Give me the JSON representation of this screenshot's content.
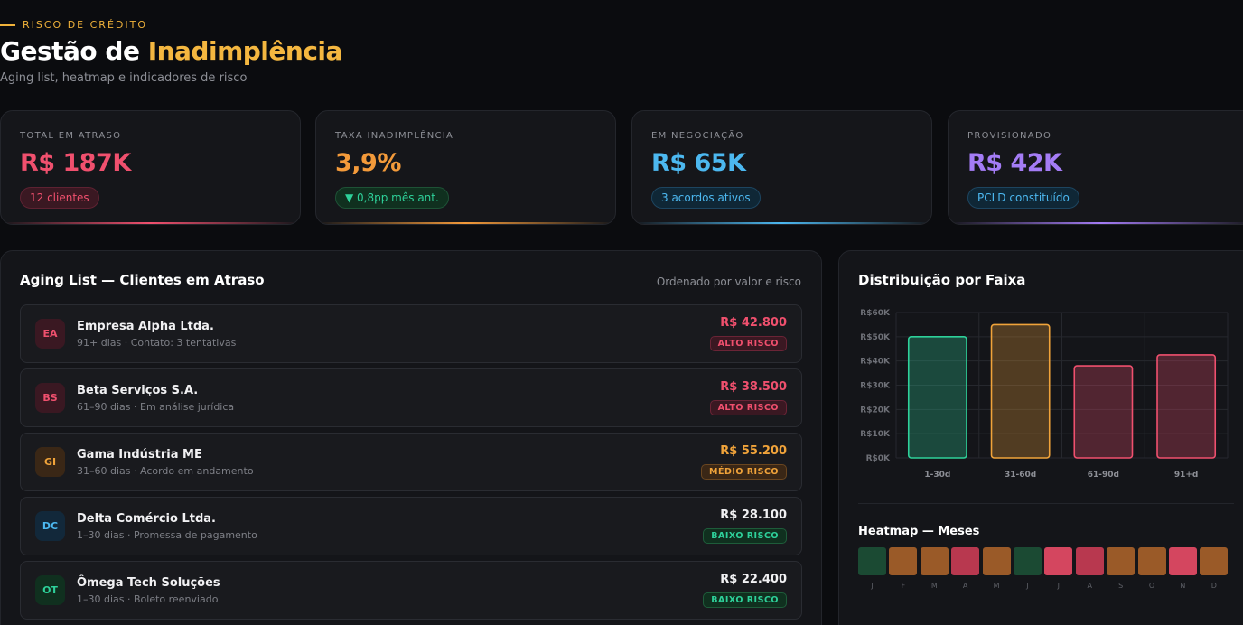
{
  "header": {
    "eyebrow": "RISCO DE CRÉDITO",
    "title_main": "Gestão de ",
    "title_highlight": "Inadimplência",
    "subtitle": "Aging list, heatmap e indicadores de risco"
  },
  "kpis": [
    {
      "label": "TOTAL EM ATRASO",
      "value": "R$ 187K",
      "badge": "12 clientes",
      "color": "#f0506e"
    },
    {
      "label": "TAXA INADIMPLÊNCIA",
      "value": "3,9%",
      "badge": "▼ 0,8pp mês ant.",
      "color": "#f39a3a"
    },
    {
      "label": "EM NEGOCIAÇÃO",
      "value": "R$ 65K",
      "badge": "3 acordos ativos",
      "color": "#4cb8f0"
    },
    {
      "label": "PROVISIONADO",
      "value": "R$ 42K",
      "badge": "PCLD constituído",
      "color": "#a47cf5"
    }
  ],
  "aging": {
    "title": "Aging List — Clientes em Atraso",
    "note": "Ordenado por valor e risco",
    "rows": [
      {
        "initials": "EA",
        "name": "Empresa Alpha Ltda.",
        "meta": "91+ dias · Contato: 3 tentativas",
        "amount": "R$ 42.800",
        "risk": "ALTO RISCO",
        "level": "high"
      },
      {
        "initials": "BS",
        "name": "Beta Serviços S.A.",
        "meta": "61–90 dias · Em análise jurídica",
        "amount": "R$ 38.500",
        "risk": "ALTO RISCO",
        "level": "high"
      },
      {
        "initials": "GI",
        "name": "Gama Indústria ME",
        "meta": "31–60 dias · Acordo em andamento",
        "amount": "R$ 55.200",
        "risk": "MÉDIO RISCO",
        "level": "medium"
      },
      {
        "initials": "DC",
        "name": "Delta Comércio Ltda.",
        "meta": "1–30 dias · Promessa de pagamento",
        "amount": "R$ 28.100",
        "risk": "BAIXO RISCO",
        "level": "low"
      },
      {
        "initials": "OT",
        "name": "Ômega Tech Soluções",
        "meta": "1–30 dias · Boleto reenviado",
        "amount": "R$ 22.400",
        "risk": "BAIXO RISCO",
        "level": "low"
      }
    ]
  },
  "distribution": {
    "title": "Distribuição por Faixa",
    "heatmap_title": "Heatmap — Meses",
    "months": [
      "J",
      "F",
      "M",
      "A",
      "M",
      "J",
      "J",
      "A",
      "S",
      "O",
      "N",
      "D"
    ],
    "heat_levels": [
      "low",
      "medium",
      "medium",
      "high",
      "medium",
      "low",
      "critical",
      "high",
      "medium",
      "medium",
      "critical",
      "medium"
    ]
  },
  "chart_data": {
    "type": "bar",
    "categories": [
      "1-30d",
      "31-60d",
      "61-90d",
      "91+d"
    ],
    "values": [
      50000,
      55000,
      38000,
      42500
    ],
    "y_ticks": [
      "R$0K",
      "R$10K",
      "R$20K",
      "R$30K",
      "R$40K",
      "R$50K",
      "R$60K"
    ],
    "ylim": [
      0,
      60000
    ],
    "bar_colors": [
      "#2ed19a",
      "#f0a33a",
      "#f0506e",
      "#f0506e"
    ],
    "grid": true
  }
}
